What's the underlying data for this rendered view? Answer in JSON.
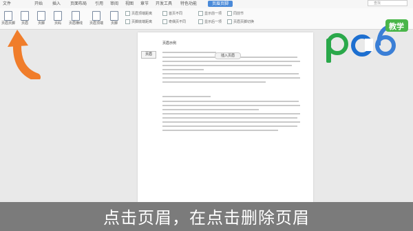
{
  "ribbon_tabs": [
    "文件",
    "开始",
    "插入",
    "页面布局",
    "引用",
    "审阅",
    "视图",
    "章节",
    "开发工具",
    "特色功能",
    "页眉页脚"
  ],
  "active_tab": "页眉页脚",
  "search_placeholder": "查找",
  "tools": [
    {
      "label": "页眉页脚"
    },
    {
      "label": "页眉"
    },
    {
      "label": "页脚"
    },
    {
      "label": "页码"
    },
    {
      "label": "页眉横线"
    }
  ],
  "tools2": [
    {
      "label": "页眉顶端"
    },
    {
      "label": "页脚"
    }
  ],
  "mini_options": [
    "页眉顶端距离",
    "页脚底端距离",
    "首页不同",
    "奇偶页不同",
    "显示前一项",
    "显示后一项",
    "同前节",
    "页眉页脚切换"
  ],
  "page_header_button": "页眉",
  "insert_menu_label": "插入页眉",
  "header_text": "页眉示例",
  "brand": {
    "name": "pc6",
    "tag": "教学",
    "colors": {
      "p": "#2aa84a",
      "c": "#1d6fd0",
      "six": "#3b7fd6",
      "tag_bg": "#4ab64a"
    }
  },
  "subtitle": "点击页眉，在点击删除页眉",
  "colors": {
    "accent": "#4a8ad9",
    "arrow": "#f07d2b"
  }
}
